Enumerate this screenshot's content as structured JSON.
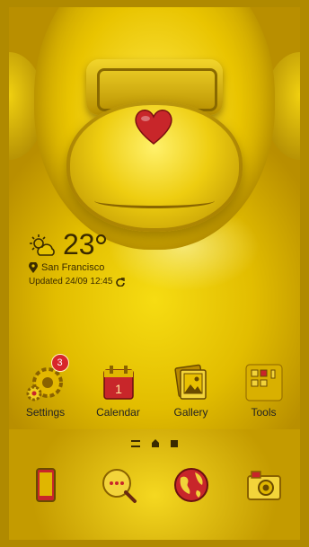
{
  "weather": {
    "temperature": "23",
    "city": "San Francisco",
    "updated": "Updated 24/09 12:45"
  },
  "apps": [
    {
      "label": "Settings",
      "icon": "gear-icon",
      "badge": "3"
    },
    {
      "label": "Calendar",
      "icon": "calendar-icon",
      "day": "1"
    },
    {
      "label": "Gallery",
      "icon": "gallery-icon"
    },
    {
      "label": "Tools",
      "icon": "tools-icon"
    }
  ],
  "dock": [
    {
      "icon": "phone-icon"
    },
    {
      "icon": "messages-icon"
    },
    {
      "icon": "browser-globe-icon"
    },
    {
      "icon": "camera-icon"
    }
  ],
  "colors": {
    "gold": "#e6c200",
    "accent_red": "#c8262a",
    "text_dark": "#3a2a00"
  }
}
